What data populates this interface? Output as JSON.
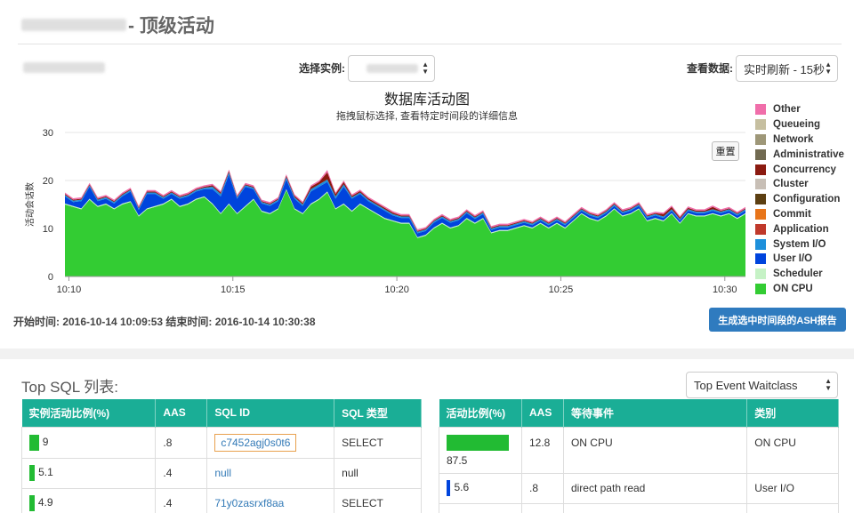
{
  "header": {
    "title_suffix": "- 顶级活动"
  },
  "controls": {
    "instance_label": "选择实例:",
    "view_label": "查看数据:",
    "view_value": "实时刷新 - 15秒"
  },
  "chart": {
    "reset_label": "重置",
    "time_range": "开始时间: 2016-10-14 10:09:53 结束时间: 2016-10-14 10:30:38",
    "ash_button": "生成选中时间段的ASH报告"
  },
  "chart_data": {
    "type": "area",
    "title": "数据库活动图",
    "subtitle": "拖拽鼠标选择, 查看特定时间段的详细信息",
    "ylabel": "活动会话数",
    "ylim": [
      0,
      30
    ],
    "yticks": [
      0,
      10,
      20,
      30
    ],
    "xlim": [
      0,
      20.75
    ],
    "xticks": [
      {
        "pos": 0.12,
        "label": "10:10"
      },
      {
        "pos": 5.12,
        "label": "10:15"
      },
      {
        "pos": 10.12,
        "label": "10:20"
      },
      {
        "pos": 15.12,
        "label": "10:25"
      },
      {
        "pos": 20.12,
        "label": "10:30"
      }
    ],
    "legend_position": "right",
    "legend": [
      {
        "name": "Other",
        "color": "#f06eaa"
      },
      {
        "name": "Queueing",
        "color": "#c6bfa0"
      },
      {
        "name": "Network",
        "color": "#9e9778"
      },
      {
        "name": "Administrative",
        "color": "#716a51"
      },
      {
        "name": "Concurrency",
        "color": "#8b1a10"
      },
      {
        "name": "Cluster",
        "color": "#c8bfb6"
      },
      {
        "name": "Configuration",
        "color": "#5c3f12"
      },
      {
        "name": "Commit",
        "color": "#e8751a"
      },
      {
        "name": "Application",
        "color": "#c0392b"
      },
      {
        "name": "System I/O",
        "color": "#1e90db"
      },
      {
        "name": "User I/O",
        "color": "#0044dd"
      },
      {
        "name": "Scheduler",
        "color": "#c6f2c6"
      },
      {
        "name": "ON CPU",
        "color": "#33cc33"
      }
    ],
    "x": [
      0,
      0.25,
      0.5,
      0.75,
      1,
      1.25,
      1.5,
      1.75,
      2,
      2.25,
      2.5,
      2.75,
      3,
      3.25,
      3.5,
      3.75,
      4,
      4.25,
      4.5,
      4.75,
      5,
      5.25,
      5.5,
      5.75,
      6,
      6.25,
      6.5,
      6.75,
      7,
      7.25,
      7.5,
      7.75,
      8,
      8.25,
      8.5,
      8.75,
      9,
      9.25,
      9.5,
      9.75,
      10,
      10.25,
      10.5,
      10.75,
      11,
      11.25,
      11.5,
      11.75,
      12,
      12.25,
      12.5,
      12.75,
      13,
      13.25,
      13.5,
      13.75,
      14,
      14.25,
      14.5,
      14.75,
      15,
      15.25,
      15.5,
      15.75,
      16,
      16.25,
      16.5,
      16.75,
      17,
      17.25,
      17.5,
      17.75,
      18,
      18.25,
      18.5,
      18.75,
      19,
      19.25,
      19.5,
      19.75,
      20,
      20.25,
      20.5,
      20.75
    ],
    "series": [
      {
        "name": "ON CPU",
        "values": [
          15,
          14.5,
          14,
          16,
          14.5,
          15,
          14,
          15,
          15.5,
          12.5,
          14,
          14.5,
          15,
          16,
          14.5,
          15,
          16,
          16.5,
          15,
          13,
          15,
          13,
          14.5,
          16,
          13.5,
          13,
          14,
          18,
          14,
          13,
          15,
          16,
          17.5,
          14,
          15,
          13.5,
          15,
          14,
          13,
          12,
          11.5,
          11,
          11,
          8,
          8.5,
          10,
          11,
          10,
          10.5,
          12,
          11,
          12,
          9,
          9.5,
          9.5,
          10,
          10.5,
          10,
          11,
          10,
          11,
          10,
          11.5,
          13,
          12,
          11.5,
          12.5,
          14,
          12.5,
          13,
          14,
          11.5,
          12,
          11.5,
          13,
          11,
          13,
          12.5,
          12.5,
          13,
          12.5,
          13,
          12,
          13
        ]
      },
      {
        "name": "Scheduler",
        "values": [
          0.2,
          0.2,
          0.2,
          0.2,
          0.2,
          0.2,
          0.2,
          0.2,
          0.2,
          0.2,
          0.2,
          0.2,
          0.2,
          0.2,
          0.2,
          0.2,
          0.2,
          0.2,
          0.2,
          0.2,
          0.2,
          0.2,
          0.2,
          0.2,
          0.2,
          0.2,
          0.2,
          0.2,
          0.2,
          0.2,
          0.2,
          0.2,
          0.2,
          0.2,
          0.2,
          0.2,
          0.2,
          0.2,
          0.2,
          0.2,
          0.2,
          0.2,
          0.2,
          0.2,
          0.2,
          0.2,
          0.2,
          0.2,
          0.2,
          0.2,
          0.2,
          0.2,
          0.2,
          0.2,
          0.2,
          0.2,
          0.2,
          0.2,
          0.2,
          0.2,
          0.2,
          0.2,
          0.2,
          0.2,
          0.2,
          0.2,
          0.2,
          0.2,
          0.2,
          0.2,
          0.2,
          0.2,
          0.2,
          0.2,
          0.2,
          0.2,
          0.2,
          0.2,
          0.2,
          0.2,
          0.2,
          0.2,
          0.2,
          0.2
        ]
      },
      {
        "name": "User I/O",
        "values": [
          1.5,
          0.8,
          1.5,
          2.5,
          1,
          1,
          1,
          1.5,
          2,
          1.2,
          3,
          2.5,
          1,
          1,
          1.5,
          1.5,
          1.5,
          1.5,
          3,
          3.5,
          6,
          3,
          4,
          2,
          1.5,
          1.5,
          1.5,
          2,
          2,
          1.5,
          2.5,
          2.5,
          2,
          2,
          3.5,
          2.5,
          2,
          1.5,
          1.5,
          1.5,
          1,
          1,
          1,
          0.8,
          0.8,
          1,
          1,
          1,
          1,
          1,
          0.8,
          0.8,
          0.5,
          0.5,
          0.5,
          0.5,
          0.5,
          0.5,
          0.5,
          0.5,
          0.5,
          0.5,
          0.5,
          0.5,
          0.5,
          0.5,
          0.5,
          0.5,
          0.5,
          0.5,
          0.5,
          0.5,
          0.5,
          0.5,
          0.5,
          0.5,
          0.5,
          0.5,
          0.5,
          0.5,
          0.5,
          0.5,
          0.5,
          0.5
        ]
      },
      {
        "name": "System I/O",
        "values": [
          0.3,
          0.3,
          0.3,
          0.3,
          0.3,
          0.3,
          0.3,
          0.3,
          0.3,
          0.3,
          0.3,
          0.3,
          0.3,
          0.3,
          0.3,
          0.3,
          0.3,
          0.3,
          0.5,
          0.5,
          0.5,
          0.3,
          0.3,
          0.3,
          0.3,
          0.3,
          0.3,
          0.5,
          0.3,
          0.3,
          0.5,
          0.5,
          0.5,
          0.5,
          0.5,
          0.3,
          0.3,
          0.3,
          0.3,
          0.3,
          0.3,
          0.3,
          0.3,
          0.3,
          0.3,
          0.3,
          0.3,
          0.3,
          0.3,
          0.3,
          0.3,
          0.3,
          0.3,
          0.3,
          0.3,
          0.3,
          0.3,
          0.3,
          0.3,
          0.3,
          0.3,
          0.3,
          0.3,
          0.3,
          0.3,
          0.3,
          0.3,
          0.3,
          0.3,
          0.3,
          0.3,
          0.3,
          0.3,
          0.3,
          0.3,
          0.3,
          0.3,
          0.3,
          0.3,
          0.3,
          0.3,
          0.3,
          0.3,
          0.3
        ]
      },
      {
        "name": "Application",
        "values": [
          0,
          0,
          0,
          0,
          0,
          0,
          0,
          0,
          0,
          0,
          0,
          0,
          0,
          0,
          0,
          0,
          0,
          0,
          0,
          0,
          0,
          0,
          0,
          0,
          0,
          0,
          0,
          0,
          0,
          0,
          0,
          0,
          0,
          0,
          0,
          0,
          0,
          0,
          0,
          0,
          0,
          0,
          0,
          0,
          0,
          0,
          0,
          0,
          0,
          0,
          0,
          0,
          0,
          0,
          0,
          0,
          0,
          0,
          0,
          0,
          0,
          0,
          0,
          0,
          0,
          0,
          0,
          0,
          0,
          0,
          0,
          0,
          0,
          0,
          0,
          0,
          0,
          0,
          0,
          0,
          0,
          0,
          0,
          0
        ]
      },
      {
        "name": "Concurrency",
        "values": [
          0.2,
          0.2,
          0.2,
          0.2,
          0.2,
          0.2,
          0.2,
          0.2,
          0.2,
          0.2,
          0.2,
          0.2,
          0.2,
          0.2,
          0.2,
          0.2,
          0.2,
          0.2,
          0.3,
          0.3,
          0.3,
          0.2,
          0.2,
          0.2,
          0.2,
          0.2,
          0.2,
          0.3,
          0.3,
          0.3,
          0.5,
          0.5,
          1.5,
          0.5,
          0.5,
          0.3,
          0.3,
          0.3,
          0.3,
          0.3,
          0.3,
          0.2,
          0.2,
          0.2,
          0.2,
          0.2,
          0.2,
          0.2,
          0.2,
          0.2,
          0.2,
          0.2,
          0.2,
          0.2,
          0.2,
          0.2,
          0.2,
          0.2,
          0.2,
          0.2,
          0.2,
          0.2,
          0.2,
          0.2,
          0.2,
          0.2,
          0.2,
          0.2,
          0.2,
          0.2,
          0.2,
          0.2,
          0.2,
          0.5,
          0.5,
          0.3,
          0.3,
          0.2,
          0.2,
          0.5,
          0.2,
          0.2,
          0.2,
          0.2
        ]
      },
      {
        "name": "Other",
        "values": [
          0.3,
          0.3,
          0.3,
          0.3,
          0.3,
          0.3,
          0.3,
          0.3,
          0.3,
          0.3,
          0.3,
          0.3,
          0.3,
          0.3,
          0.3,
          0.3,
          0.3,
          0.3,
          0.3,
          0.3,
          0.3,
          0.3,
          0.3,
          0.3,
          0.3,
          0.3,
          0.3,
          0.3,
          0.3,
          0.3,
          0.3,
          0.3,
          0.5,
          0.3,
          0.3,
          0.3,
          0.3,
          0.3,
          0.3,
          0.3,
          0.3,
          0.3,
          0.3,
          0.3,
          0.3,
          0.3,
          0.3,
          0.3,
          0.3,
          0.3,
          0.3,
          0.3,
          0.3,
          0.3,
          0.3,
          0.3,
          0.3,
          0.3,
          0.3,
          0.3,
          0.3,
          0.3,
          0.3,
          0.3,
          0.3,
          0.3,
          0.3,
          0.3,
          0.3,
          0.3,
          0.3,
          0.3,
          0.3,
          0.3,
          0.3,
          0.3,
          0.3,
          0.3,
          0.3,
          0.3,
          0.3,
          0.3,
          0.3,
          0.3
        ]
      }
    ]
  },
  "top_sql": {
    "heading": "Top SQL 列表:",
    "columns": [
      "实例活动比例(%)",
      "AAS",
      "SQL ID",
      "SQL 类型"
    ],
    "rows": [
      {
        "pct": "9",
        "pct_value": 9,
        "aas": ".8",
        "sql_id": "c7452agj0s0t6",
        "type": "SELECT"
      },
      {
        "pct": "5.1",
        "pct_value": 5.1,
        "aas": ".4",
        "sql_id": "null",
        "type": "null"
      },
      {
        "pct": "4.9",
        "pct_value": 4.9,
        "aas": ".4",
        "sql_id": "71y0zasrxf8aa",
        "type": "SELECT"
      }
    ],
    "bar_color": "#22bb33"
  },
  "top_event": {
    "select_value": "Top Event Waitclass",
    "columns": [
      "活动比例(%)",
      "AAS",
      "等待事件",
      "类别"
    ],
    "rows": [
      {
        "pct": "87.5",
        "pct_value": 87.5,
        "aas": "12.8",
        "event": "ON CPU",
        "class": "ON CPU",
        "bar_color": "#22bb33"
      },
      {
        "pct": "5.6",
        "pct_value": 5.6,
        "aas": ".8",
        "event": "direct path read",
        "class": "User I/O",
        "bar_color": "#0044dd"
      }
    ]
  }
}
